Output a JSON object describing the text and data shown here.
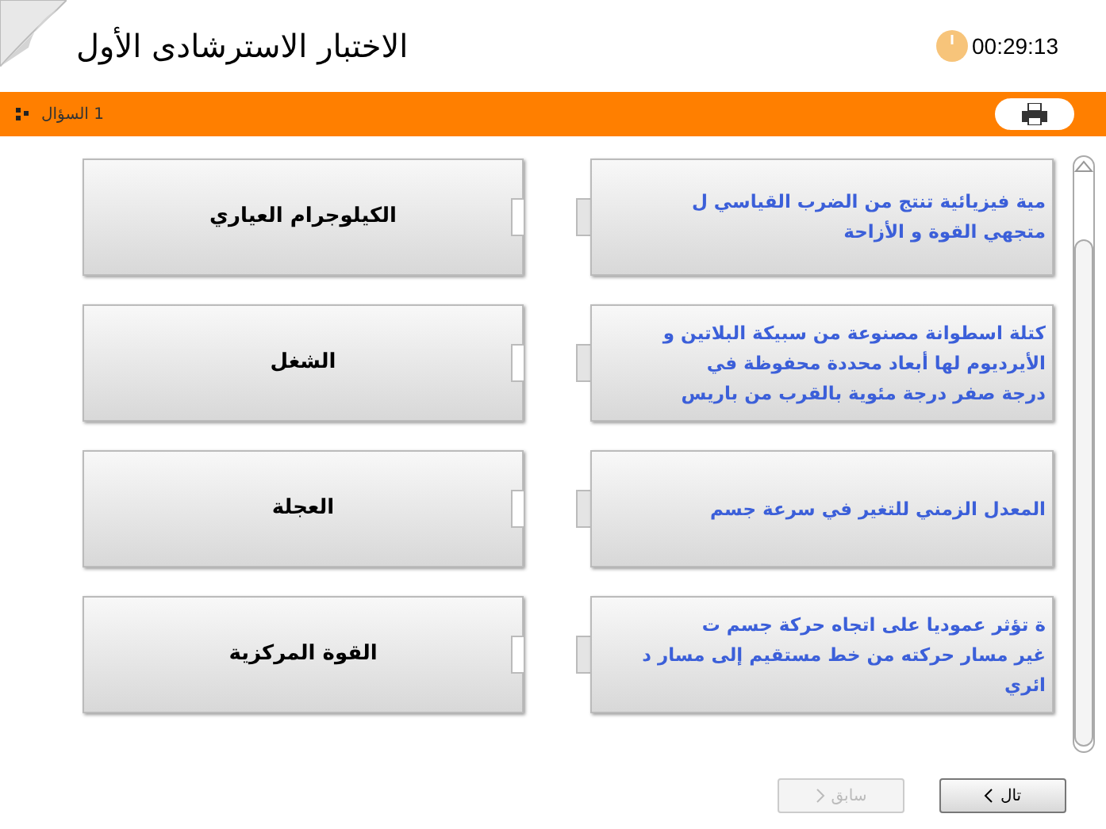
{
  "header": {
    "title": "الاختبار الاسترشادى الأول",
    "timer": "00:29:13"
  },
  "toolbar": {
    "question": "1 السؤال"
  },
  "pairs": [
    {
      "term": "الكيلوجرام العياري",
      "definition": [
        "مية فيزيائية تنتج من الضرب القياسي ل",
        "متجهي القوة و الأزاحة"
      ]
    },
    {
      "term": "الشغل",
      "definition": [
        "كتلة اسطوانة مصنوعة من سبيكة البلاتين و",
        "الأيرديوم لها أبعاد محددة محفوظة في",
        "درجة صفر درجة مئوية بالقرب من باريس"
      ]
    },
    {
      "term": "العجلة",
      "definition": [
        "المعدل الزمني للتغير في سرعة جسم"
      ]
    },
    {
      "term": "القوة المركزية",
      "definition": [
        "ة تؤثر عموديا على اتجاه حركة جسم ت",
        "غير مسار حركته من خط مستقيم إلى مسار د",
        "ائري"
      ]
    }
  ],
  "buttons": [
    {
      "label": "تال",
      "kind": "next",
      "disabled": false
    },
    {
      "label": "سابق",
      "kind": "previous",
      "disabled": true
    }
  ]
}
